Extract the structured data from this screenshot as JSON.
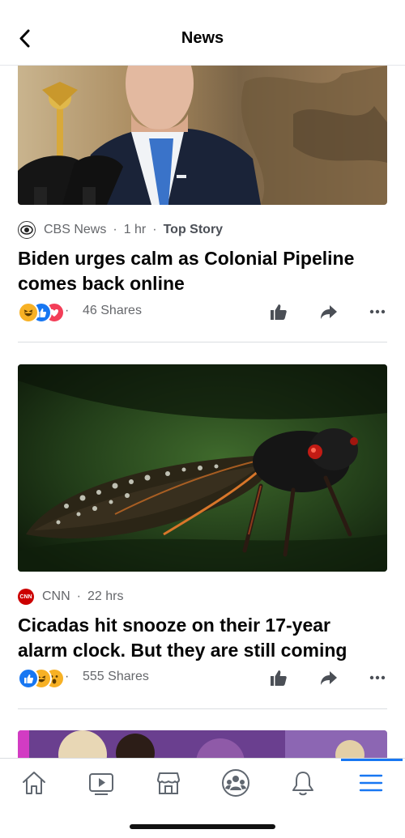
{
  "header": {
    "title": "News"
  },
  "posts": [
    {
      "source": "CBS News",
      "time": "1 hr",
      "tag": "Top Story",
      "headline_line1": "Biden urges calm as Colonial Pipeline",
      "headline_line2": "comes back online",
      "shares": "46 Shares",
      "reactions": [
        "haha",
        "like",
        "love"
      ]
    },
    {
      "source": "CNN",
      "time": "22 hrs",
      "headline_line1": "Cicadas hit snooze on their 17-year",
      "headline_line2": "alarm clock. But they are still coming",
      "shares": "555 Shares",
      "reactions": [
        "like",
        "haha",
        "wow"
      ]
    }
  ],
  "logo_text": {
    "cnn": "CNN"
  },
  "colors": {
    "accent": "#1877f2",
    "like": "#1877f2",
    "love": "#f33e58",
    "haha": "#f7b125",
    "cnn": "#cc0000"
  },
  "tabs": [
    "home-icon",
    "watch-icon",
    "marketplace-icon",
    "groups-icon",
    "notifications-icon",
    "menu-icon"
  ],
  "active_tab": "menu-icon"
}
